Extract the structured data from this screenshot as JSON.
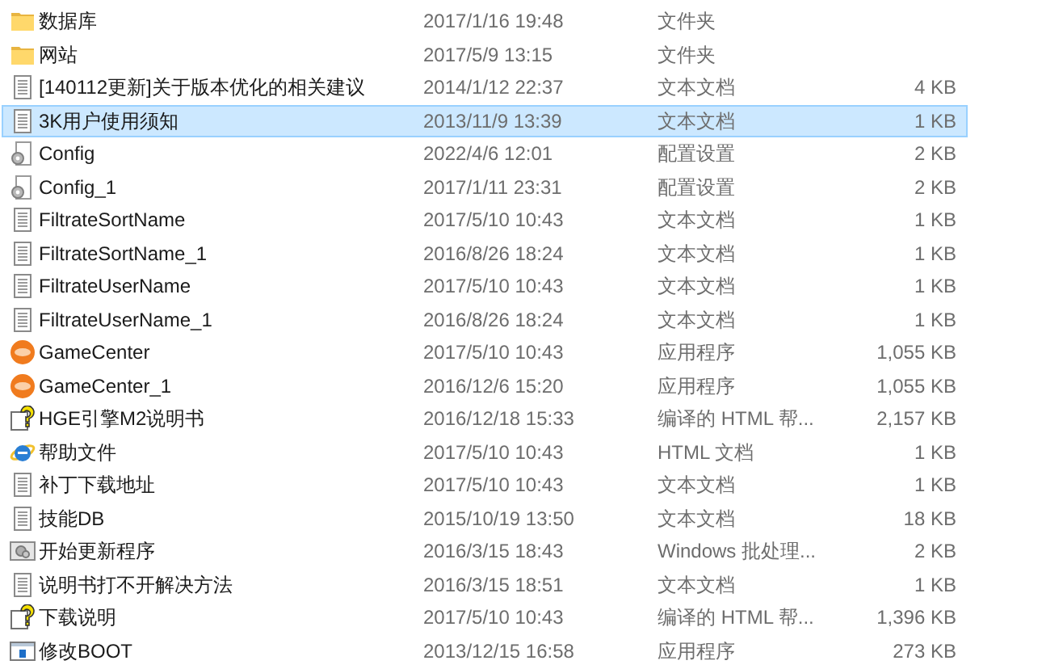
{
  "files": [
    {
      "name": "数据库",
      "modified": "2017/1/16 19:48",
      "type": "文件夹",
      "kind": "folder",
      "selected": false
    },
    {
      "name": "网站",
      "modified": "2017/5/9 13:15",
      "type": "文件夹",
      "kind": "folder",
      "selected": false
    },
    {
      "name": "[140112更新]关于版本优化的相关建议",
      "modified": "2014/1/12 22:37",
      "type": "文本文档",
      "size": "4 KB",
      "kind": "text",
      "selected": false
    },
    {
      "name": "3K用户使用须知",
      "modified": "2013/11/9 13:39",
      "type": "文本文档",
      "size": "1 KB",
      "kind": "text",
      "selected": true
    },
    {
      "name": "Config",
      "modified": "2022/4/6 12:01",
      "type": "配置设置",
      "size": "2 KB",
      "kind": "config",
      "selected": false
    },
    {
      "name": "Config_1",
      "modified": "2017/1/11 23:31",
      "type": "配置设置",
      "size": "2 KB",
      "kind": "config",
      "selected": false
    },
    {
      "name": "FiltrateSortName",
      "modified": "2017/5/10 10:43",
      "type": "文本文档",
      "size": "1 KB",
      "kind": "text",
      "selected": false
    },
    {
      "name": "FiltrateSortName_1",
      "modified": "2016/8/26 18:24",
      "type": "文本文档",
      "size": "1 KB",
      "kind": "text",
      "selected": false
    },
    {
      "name": "FiltrateUserName",
      "modified": "2017/5/10 10:43",
      "type": "文本文档",
      "size": "1 KB",
      "kind": "text",
      "selected": false
    },
    {
      "name": "FiltrateUserName_1",
      "modified": "2016/8/26 18:24",
      "type": "文本文档",
      "size": "1 KB",
      "kind": "text",
      "selected": false
    },
    {
      "name": "GameCenter",
      "modified": "2017/5/10 10:43",
      "type": "应用程序",
      "size": "1,055 KB",
      "kind": "game",
      "selected": false
    },
    {
      "name": "GameCenter_1",
      "modified": "2016/12/6 15:20",
      "type": "应用程序",
      "size": "1,055 KB",
      "kind": "game",
      "selected": false
    },
    {
      "name": "HGE引擎M2说明书",
      "modified": "2016/12/18 15:33",
      "type": "编译的 HTML 帮...",
      "size": "2,157 KB",
      "kind": "help",
      "selected": false
    },
    {
      "name": "帮助文件",
      "modified": "2017/5/10 10:43",
      "type": "HTML 文档",
      "size": "1 KB",
      "kind": "html",
      "selected": false
    },
    {
      "name": "补丁下载地址",
      "modified": "2017/5/10 10:43",
      "type": "文本文档",
      "size": "1 KB",
      "kind": "text",
      "selected": false
    },
    {
      "name": "技能DB",
      "modified": "2015/10/19 13:50",
      "type": "文本文档",
      "size": "18 KB",
      "kind": "text",
      "selected": false
    },
    {
      "name": "开始更新程序",
      "modified": "2016/3/15 18:43",
      "type": "Windows 批处理...",
      "size": "2 KB",
      "kind": "batch",
      "selected": false
    },
    {
      "name": "说明书打不开解决方法",
      "modified": "2016/3/15 18:51",
      "type": "文本文档",
      "size": "1 KB",
      "kind": "text",
      "selected": false
    },
    {
      "name": "下载说明",
      "modified": "2017/5/10 10:43",
      "type": "编译的 HTML 帮...",
      "size": "1,396 KB",
      "kind": "help",
      "selected": false
    },
    {
      "name": "修改BOOT",
      "modified": "2013/12/15 16:58",
      "type": "应用程序",
      "size": "273 KB",
      "kind": "app",
      "selected": false
    }
  ]
}
